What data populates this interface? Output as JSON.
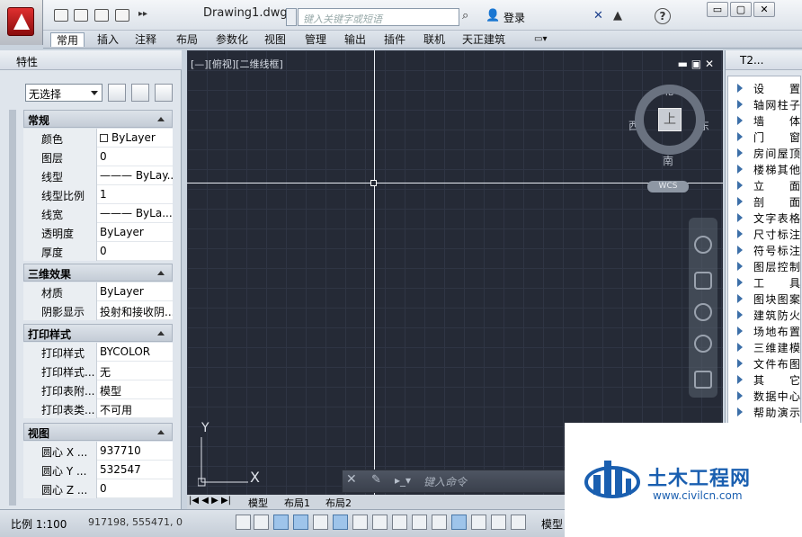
{
  "title_bar": {
    "document_title": "Drawing1.dwg",
    "search_placeholder": "键入关键字或短语",
    "login_label": "登录",
    "help_label": "?"
  },
  "window_controls": {
    "minimize": "▭",
    "restore": "▢",
    "close": "✕"
  },
  "ribbon": {
    "tabs": [
      "常用",
      "插入",
      "注释",
      "布局",
      "参数化",
      "视图",
      "管理",
      "输出",
      "插件",
      "联机",
      "天正建筑"
    ],
    "active_tab": "常用"
  },
  "properties_panel": {
    "title": "特性",
    "selection_dropdown": "无选择",
    "sections": [
      {
        "name": "常规",
        "rows": [
          {
            "label": "颜色",
            "value": "ByLayer"
          },
          {
            "label": "图层",
            "value": "0"
          },
          {
            "label": "线型",
            "value": "——— ByLay..."
          },
          {
            "label": "线型比例",
            "value": "1"
          },
          {
            "label": "线宽",
            "value": "——— ByLa..."
          },
          {
            "label": "透明度",
            "value": "ByLayer"
          },
          {
            "label": "厚度",
            "value": "0"
          }
        ]
      },
      {
        "name": "三维效果",
        "rows": [
          {
            "label": "材质",
            "value": "ByLayer"
          },
          {
            "label": "阴影显示",
            "value": "投射和接收阴..."
          }
        ]
      },
      {
        "name": "打印样式",
        "rows": [
          {
            "label": "打印样式",
            "value": "BYCOLOR"
          },
          {
            "label": "打印样式...",
            "value": "无"
          },
          {
            "label": "打印表附...",
            "value": "模型"
          },
          {
            "label": "打印表类...",
            "value": "不可用"
          }
        ]
      },
      {
        "name": "视图",
        "rows": [
          {
            "label": "圆心 X ...",
            "value": "937710"
          },
          {
            "label": "圆心 Y ...",
            "value": "532547"
          },
          {
            "label": "圆心 Z ...",
            "value": "0"
          }
        ]
      }
    ]
  },
  "viewport": {
    "label": "[—][俯视][二维线框]",
    "viewcube": {
      "face": "上",
      "north": "北",
      "south": "南",
      "east": "东",
      "west": "西",
      "wcs": "WCS"
    },
    "ucs": {
      "x": "X",
      "y": "Y"
    },
    "command_placeholder": "键入命令",
    "layout_tabs": [
      "模型",
      "布局1",
      "布局2"
    ]
  },
  "t2_panel": {
    "title": "T2...",
    "items": [
      "设　置",
      "轴网柱子",
      "墙　体",
      "门　窗",
      "房间屋顶",
      "楼梯其他",
      "立　面",
      "剖　面",
      "文字表格",
      "尺寸标注",
      "符号标注",
      "图层控制",
      "工　具",
      "图块图案",
      "建筑防火",
      "场地布置",
      "三维建模",
      "文件布图",
      "其　它",
      "数据中心",
      "帮助演示"
    ]
  },
  "status_bar": {
    "scale": "比例 1:100",
    "coordinates": "917198,  555471, 0",
    "model": "模型"
  },
  "watermark": {
    "brand": "土木工程网",
    "url": "www.civilcn.com"
  },
  "colors": {
    "canvas_bg": "#252a36",
    "accent": "#1a5fb0",
    "logo_red": "#c81e1e"
  }
}
